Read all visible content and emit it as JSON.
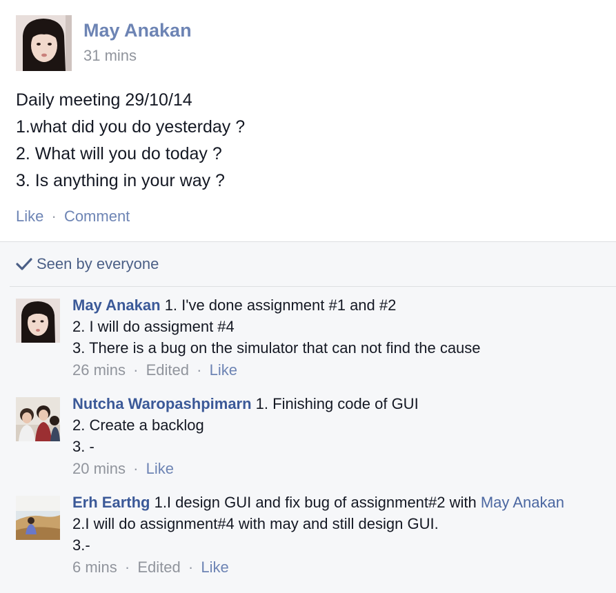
{
  "post": {
    "author": "May Anakan",
    "time": "31 mins",
    "lines": [
      "Daily meeting 29/10/14",
      "1.what did you do yesterday ?",
      "2. What will you do today ?",
      "3. Is anything in your way ?"
    ],
    "actions": {
      "like": "Like",
      "separator": "·",
      "comment": "Comment"
    }
  },
  "seen": {
    "icon": "checkmark-icon",
    "label": "Seen by everyone"
  },
  "comments": [
    {
      "author": "May Anakan",
      "first_line": " 1. I've done assignment #1 and #2",
      "lines": [
        "2. I will do assigment #4",
        "3. There is a bug on the simulator that can not find the cause"
      ],
      "time": "26 mins",
      "edited": "Edited",
      "like": "Like"
    },
    {
      "author": "Nutcha Waropashpimarn",
      "first_line": " 1. Finishing code of GUI",
      "lines": [
        "2. Create a backlog",
        "3. -"
      ],
      "time": "20 mins",
      "like": "Like"
    },
    {
      "author": "Erh Earthg",
      "first_line": " 1.I design GUI and fix bug of assignment#2 with ",
      "mention": "May Anakan",
      "lines": [
        "2.I will do assignment#4 with may and still design GUI.",
        "3.-"
      ],
      "time": "6 mins",
      "edited": "Edited",
      "like": "Like"
    }
  ],
  "colors": {
    "link": "#3b5998",
    "muted": "#90949c",
    "feedback_bg": "#f6f7f9"
  }
}
